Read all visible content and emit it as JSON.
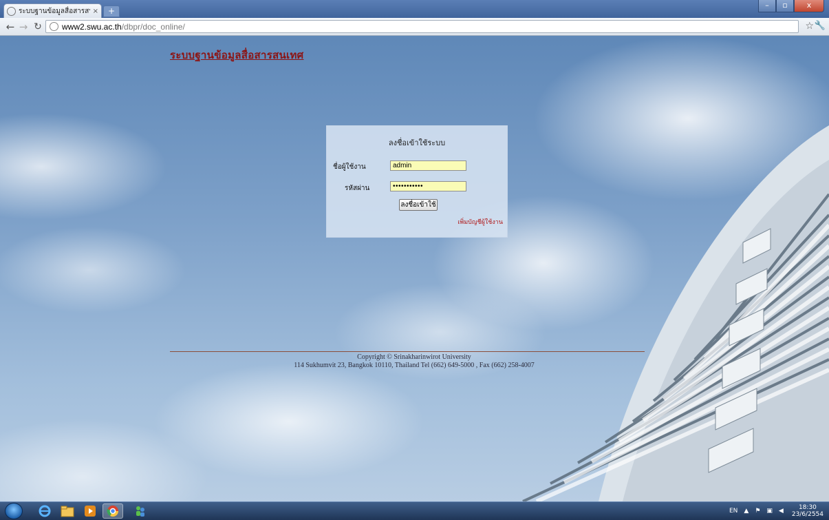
{
  "browser": {
    "tab_title": "ระบบฐานข้อมูลสื่อสารสนเทศเพื่อ",
    "tab_close": "×",
    "new_tab": "+",
    "url_host": "www2.swu.ac.th",
    "url_path": "/dbpr/doc_online/",
    "window_controls": {
      "minimize": "–",
      "maximize": "▫",
      "close": "x"
    }
  },
  "page": {
    "site_title": "ระบบฐานข้อมูลสื่อสารสนเทศ",
    "login": {
      "heading": "ลงชื่อเข้าใช้ระบบ",
      "username_label": "ชื่อผู้ใช้งาน",
      "username_value": "admin",
      "password_label": "รหัสผ่าน",
      "password_value": "•••••••••••",
      "submit_label": "ลงชื่อเข้าใช้",
      "signup_link": "เพิ่มบัญชีผู้ใช้งาน"
    },
    "footer": {
      "copyright": "Copyright © Srinakharinwirot University",
      "address": "114 Sukhumvit 23, Bangkok 10110, Thailand Tel (662) 649-5000 , Fax (662) 258-4007"
    }
  },
  "taskbar": {
    "apps": [
      "windows-start",
      "internet-explorer",
      "windows-explorer",
      "media-player",
      "chrome",
      "msn-messenger"
    ],
    "tray": {
      "language": "EN",
      "time": "18:30",
      "date": "23/6/2554"
    }
  }
}
